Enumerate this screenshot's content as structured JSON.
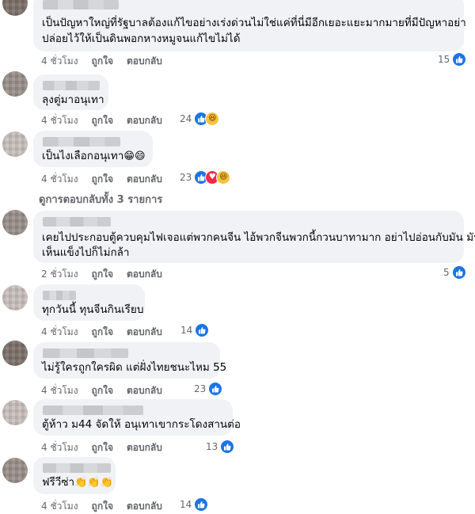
{
  "labels": {
    "like": "ถูกใจ",
    "reply": "ตอบกลับ"
  },
  "comments": [
    {
      "text_lines": [
        "เป็นปัญหาใหญ่ที่รัฐบาลต้องแก้ไขอย่างเร่งด่วนไม่ใช่แค่ที่นี่มีอีกเยอะแยะมากมายที่มีปัญหาอย่า",
        "ปล่อยไว้ให้เป็นดินพอกหางหมูจนแก้ไขไม่ได้"
      ],
      "time": "4 ชั่วโมง",
      "reaction_count": "15"
    },
    {
      "text_lines": [
        "ลุงตู่มาอนุเทา"
      ],
      "time": "4 ชั่วโมง",
      "reaction_count": "24"
    },
    {
      "text_lines": [
        "เป็นไงเลือกอนุเทา"
      ],
      "emoji": "😁😄",
      "time": "4 ชั่วโมง",
      "reaction_count": "23"
    },
    {
      "text_lines": [
        "เคยไปประกอบตู้ควบคุมไฟเจอแต่พวกคนจีน ไอ้พวกจีนพวกนี้กวนบาทามาก อย่าไปอ่อนกับมัน มัน",
        "เห็นแข็งไปก็ไม่กล้า"
      ],
      "time": "2 ชั่วโมง",
      "reaction_count": "5"
    },
    {
      "text_lines": [
        "ทุกวันนี้ ทุนจีนกินเรียบ"
      ],
      "time": "4 ชั่วโมง",
      "reaction_count": "14"
    },
    {
      "text_lines": [
        "ไม่รู้ใครถูกใครผิด แต่ฝั่งไทยชนะไหม 55"
      ],
      "time": "4 ชั่วโมง",
      "reaction_count": "23"
    },
    {
      "text_lines": [
        "ตู้ห้าว ม44 จัดให้ อนุเทาเขากระโดงสานต่อ"
      ],
      "time": "4 ชั่วโมง",
      "reaction_count": "13"
    },
    {
      "text_lines": [
        "ฟรีวีซ่า"
      ],
      "emoji": "👏👏👏",
      "time": "4 ชั่วโมง",
      "reaction_count": "14"
    }
  ],
  "replies_link": "ดูการตอบกลับทั้ง 3 รายการ",
  "colors": {
    "like_blue": "#1b74e4",
    "bubble_bg": "#f0f2f5",
    "meta_gray": "#65676b"
  }
}
